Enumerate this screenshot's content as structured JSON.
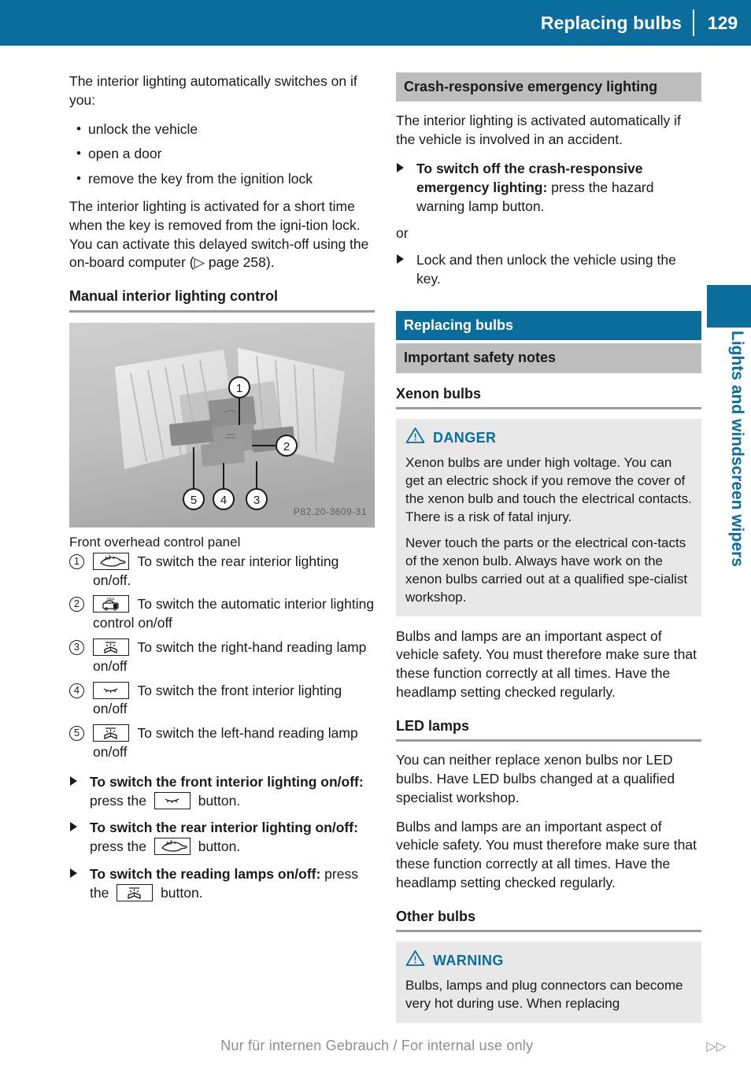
{
  "header": {
    "title": "Replacing bulbs",
    "page_number": "129"
  },
  "side_tab": {
    "label": "Lights and windscreen wipers"
  },
  "footer": {
    "text": "Nur für internen Gebrauch / For internal use only",
    "arrows": "▷▷"
  },
  "colors": {
    "accent_blue": "#0a6d9c",
    "bar_gray": "#bdbdbd",
    "notice_bg": "#e8e8e8",
    "rule_gray": "#9a9a9a"
  },
  "left_column": {
    "intro_paragraph": "The interior lighting automatically switches on if you:",
    "bullets": [
      "unlock the vehicle",
      "open a door",
      "remove the key from the ignition lock"
    ],
    "delayed_paragraph": "The interior lighting is activated for a short time when the key is removed from the igni-tion lock. You can activate this delayed switch-off using the on-board computer (▷ page 258).",
    "section_heading": "Manual interior lighting control",
    "figure": {
      "caption": "Front overhead control panel",
      "image_code": "P82.20-3609-31",
      "callout_labels": [
        "1",
        "2",
        "3",
        "4",
        "5"
      ]
    },
    "callouts": [
      {
        "number": "1",
        "icon": "rear-interior-lighting-icon",
        "text": "To switch the rear interior lighting on/off."
      },
      {
        "number": "2",
        "icon": "automatic-interior-lighting-off-icon",
        "text": "To switch the automatic interior lighting control on/off"
      },
      {
        "number": "3",
        "icon": "reading-lamp-icon",
        "text": "To switch the right-hand reading lamp on/off"
      },
      {
        "number": "4",
        "icon": "front-interior-lighting-icon",
        "text": "To switch the front interior lighting on/off"
      },
      {
        "number": "5",
        "icon": "reading-lamp-icon",
        "text": "To switch the left-hand reading lamp on/off"
      }
    ],
    "steps": [
      {
        "bold": "To switch the front interior lighting on/off:",
        "before_icon": " press the ",
        "icon": "front-interior-lighting-icon",
        "after_icon": " button."
      },
      {
        "bold": "To switch the rear interior lighting on/off:",
        "before_icon": " press the ",
        "icon": "rear-interior-lighting-icon",
        "after_icon": " button."
      },
      {
        "bold": "To switch the reading lamps on/off:",
        "before_icon": " press the ",
        "icon": "reading-lamp-icon",
        "after_icon": " button."
      }
    ]
  },
  "right_column": {
    "crash_section": {
      "bar_title": "Crash-responsive emergency lighting",
      "paragraph": "The interior lighting is activated automatically if the vehicle is involved in an accident.",
      "step_bold": "To switch off the crash-responsive emergency lighting:",
      "step_rest": " press the hazard warning lamp button.",
      "or_label": "or",
      "step2": "Lock and then unlock the vehicle using the key."
    },
    "replacing_section": {
      "bar_blue_title": "Replacing bulbs",
      "bar_gray_title": "Important safety notes",
      "xenon_heading": "Xenon bulbs",
      "danger": {
        "label": "DANGER",
        "paragraphs": [
          "Xenon bulbs are under high voltage. You can get an electric shock if you remove the cover of the xenon bulb and touch the electrical contacts. There is a risk of fatal injury.",
          "Never touch the parts or the electrical con-tacts of the xenon bulb. Always have work on the xenon bulbs carried out at a qualified spe-cialist workshop."
        ]
      },
      "xenon_paragraph": "Bulbs and lamps are an important aspect of vehicle safety. You must therefore make sure that these function correctly at all times. Have the headlamp setting checked regularly.",
      "led_heading": "LED lamps",
      "led_paragraph_1": "You can neither replace xenon bulbs nor LED bulbs. Have LED bulbs changed at a qualified specialist workshop.",
      "led_paragraph_2": "Bulbs and lamps are an important aspect of vehicle safety. You must therefore make sure that these function correctly at all times. Have the headlamp setting checked regularly.",
      "other_heading": "Other bulbs",
      "warning": {
        "label": "WARNING",
        "paragraphs": [
          "Bulbs, lamps and plug connectors can become very hot during use. When replacing"
        ]
      }
    }
  }
}
